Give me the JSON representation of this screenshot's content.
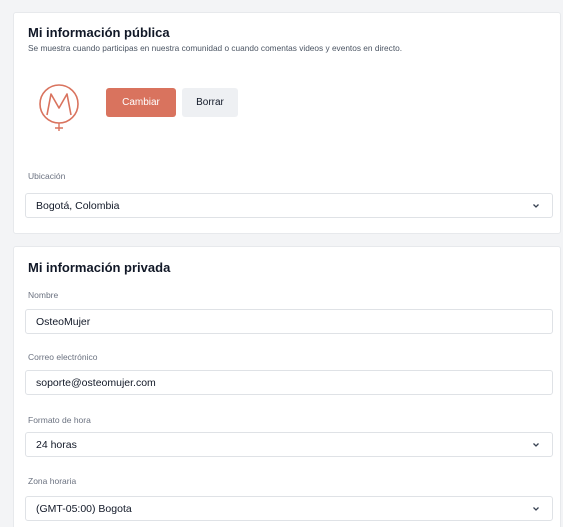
{
  "public_section": {
    "title": "Mi información pública",
    "subtitle": "Se muestra cuando participas en nuestra comunidad o cuando comentas videos y eventos en directo.",
    "change_button": "Cambiar",
    "delete_button": "Borrar",
    "location_label": "Ubicación",
    "location_value": "Bogotá, Colombia"
  },
  "private_section": {
    "title": "Mi información privada",
    "name_label": "Nombre",
    "name_value": "OsteoMujer",
    "email_label": "Correo electrónico",
    "email_value": "soporte@osteomujer.com",
    "time_format_label": "Formato de hora",
    "time_format_value": "24 horas",
    "timezone_label": "Zona horaria",
    "timezone_value": "(GMT-05:00) Bogota"
  },
  "colors": {
    "accent": "#d9735e",
    "page_background": "#f3f4f6"
  },
  "icons": {
    "avatar": "osteomujer-logo",
    "dropdown": "chevron-down-icon"
  }
}
